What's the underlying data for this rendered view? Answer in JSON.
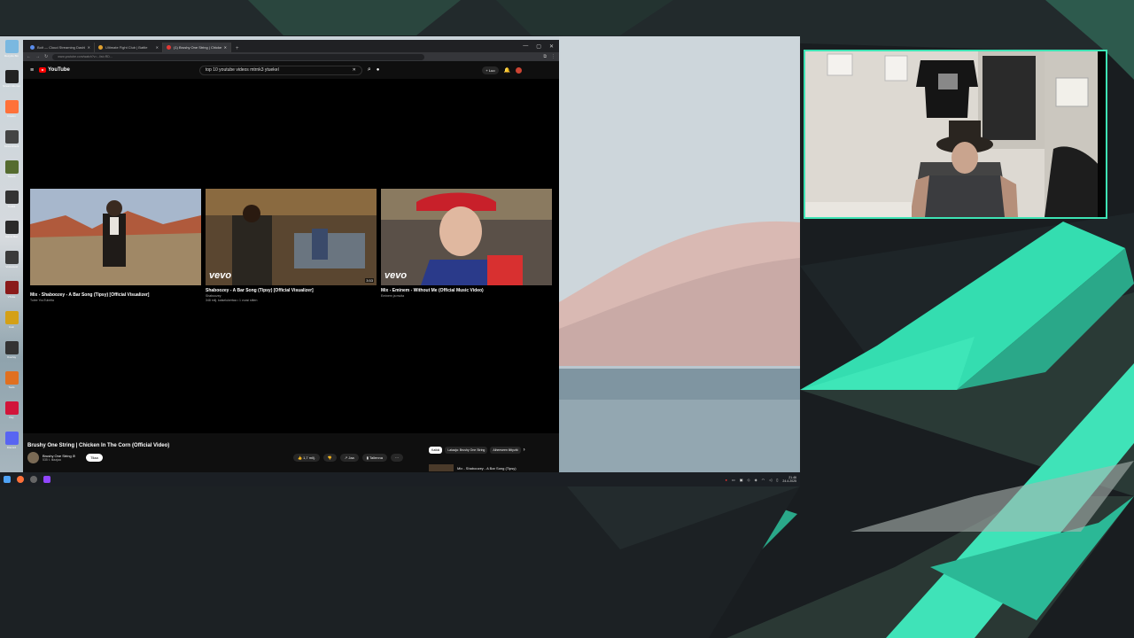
{
  "desktop_icons": [
    {
      "label": "Recycle Bin",
      "color": "#7ab8e0"
    },
    {
      "label": "Stream Elements",
      "color": "#222222"
    },
    {
      "label": "Firefox",
      "color": "#ff7139"
    },
    {
      "label": "StreamDeck",
      "color": "#444444"
    },
    {
      "label": "Steam",
      "color": "#556b2f"
    },
    {
      "label": "Toolkit",
      "color": "#333333"
    },
    {
      "label": "Game Bar",
      "color": "#2a2a2a"
    },
    {
      "label": "Voicemod",
      "color": "#3a3a3a"
    },
    {
      "label": "VTube",
      "color": "#8a1a1a"
    },
    {
      "label": "Coin",
      "color": "#d4a017"
    },
    {
      "label": "Overlay",
      "color": "#333333"
    },
    {
      "label": "Tools",
      "color": "#e07020"
    },
    {
      "label": "Pay",
      "color": "#d2143a"
    },
    {
      "label": "Discord",
      "color": "#5865f2"
    }
  ],
  "browser": {
    "tabs": [
      {
        "label": "Bolt — Cloud Streaming Dashboard",
        "active": false
      },
      {
        "label": "Ultimate Fight Club | Battle",
        "active": false
      },
      {
        "label": "(1) Brushy One String | Chicken",
        "active": true
      }
    ],
    "new_tab": "+",
    "window_controls": [
      "—",
      "▢",
      "✕"
    ],
    "url": "www.youtube.com/watch?v=...list=RD...",
    "youtube": {
      "logo": "YouTube",
      "search_value": "top 10 youtube videos mtrnk3 ytuekel",
      "create_label": "+ Luo"
    },
    "end_screen": [
      {
        "title": "Mix - Shaboozey - A Bar Song (Tipsy) [Official Visualizer]",
        "sub": "Tulee YouTubelta",
        "duration": "",
        "vevo": false
      },
      {
        "title": "Shaboozey - A Bar Song (Tipsy) [Official Visualizer]",
        "sub": "Shaboozey",
        "sub2": "348 milj. katselukertaa • 1 vuosi sitten",
        "duration": "3:53",
        "vevo": true
      },
      {
        "title": "Mix - Eminem - Without Me (Official Music Video)",
        "sub": "Eminem ja muita",
        "duration": "",
        "vevo": true
      }
    ],
    "video_title": "Brushy One String | Chicken In The Corn (Official Video)",
    "channel_name": "Brushy One String ⊘",
    "channel_subs": "535 t. tilaajaa",
    "subscribe_label": "Tilaa",
    "like_count": "1,7 milj.",
    "share_label": "Jaa",
    "save_label": "Tallenna",
    "more_label": "⋯",
    "chips": [
      "Kaikki",
      "Lataaja: Brushy One String",
      "Aiheeseen liittyvät"
    ],
    "next_up": "Mix - Shaboozey - A Bar Song (Tipsy)"
  },
  "taskbar": {
    "clock_time": "21.46",
    "clock_date": "24.4.2025"
  },
  "colors": {
    "cam_border": "#3de3b4",
    "accent_green": "#34ddb0",
    "yt_red": "#ff0000"
  }
}
